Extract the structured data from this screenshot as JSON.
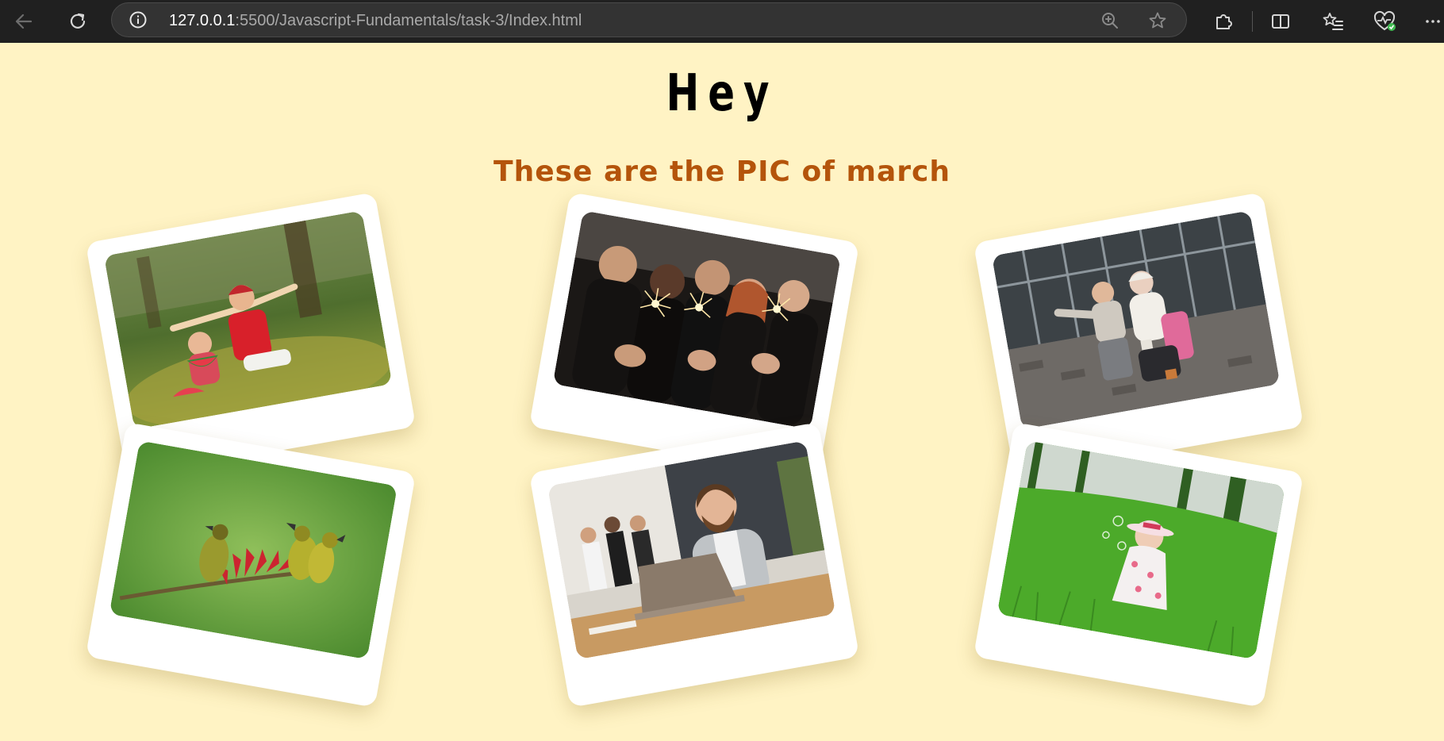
{
  "browser": {
    "url_host": "127.0.0.1",
    "url_path": ":5500/Javascript-Fundamentals/task-3/Index.html"
  },
  "page": {
    "heading": "Hey",
    "subheading": "These are the PIC of march"
  },
  "photos": [
    {
      "subject": "children-watermelon-picnic"
    },
    {
      "subject": "friends-with-sparklers"
    },
    {
      "subject": "travelers-with-luggage"
    },
    {
      "subject": "birds-on-branch"
    },
    {
      "subject": "man-with-laptop"
    },
    {
      "subject": "girl-blowing-bubbles-on-grass"
    }
  ],
  "colors": {
    "background": "#fff3c4",
    "subheading": "#b4540b",
    "heading": "#000000",
    "chrome": "#202020"
  }
}
